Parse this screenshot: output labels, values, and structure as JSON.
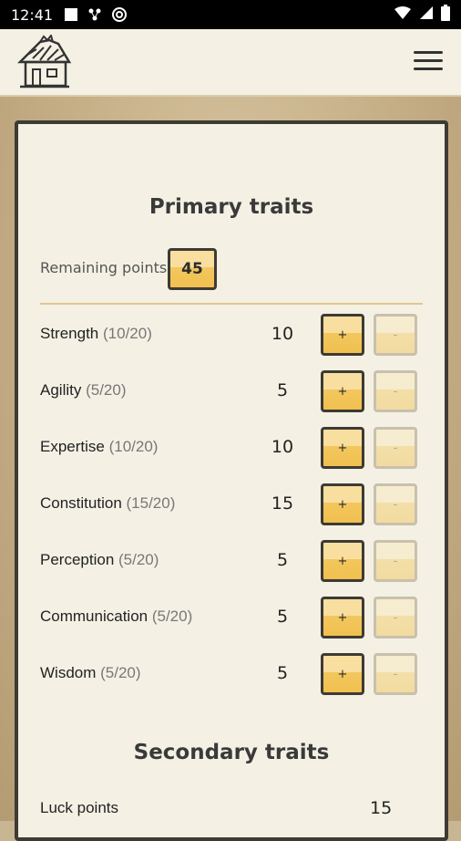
{
  "status_bar": {
    "time": "12:41",
    "icons": [
      "square-icon",
      "network-icon",
      "vpn-icon",
      "wifi-icon",
      "signal-icon",
      "battery-icon"
    ]
  },
  "header": {
    "logo_icon": "house-logo-icon",
    "menu_icon": "hamburger-menu-icon"
  },
  "primary": {
    "title": "Primary traits",
    "remaining_label": "Remaining points",
    "remaining_value": "45",
    "traits": [
      {
        "name": "Strength",
        "range": "(10/20)",
        "value": "10",
        "plus": "+",
        "minus": "-"
      },
      {
        "name": "Agility",
        "range": "(5/20)",
        "value": "5",
        "plus": "+",
        "minus": "-"
      },
      {
        "name": "Expertise",
        "range": "(10/20)",
        "value": "10",
        "plus": "+",
        "minus": "-"
      },
      {
        "name": "Constitution",
        "range": "(15/20)",
        "value": "15",
        "plus": "+",
        "minus": "-"
      },
      {
        "name": "Perception",
        "range": "(5/20)",
        "value": "5",
        "plus": "+",
        "minus": "-"
      },
      {
        "name": "Communication",
        "range": "(5/20)",
        "value": "5",
        "plus": "+",
        "minus": "-"
      },
      {
        "name": "Wisdom",
        "range": "(5/20)",
        "value": "5",
        "plus": "+",
        "minus": "-"
      }
    ]
  },
  "secondary": {
    "title": "Secondary traits",
    "luck_label": "Luck points",
    "luck_value": "15"
  },
  "colors": {
    "accent": "#f3c75e",
    "border": "#3e3a34",
    "card_bg": "#f4f1e4",
    "page_bg": "#c8b592"
  }
}
